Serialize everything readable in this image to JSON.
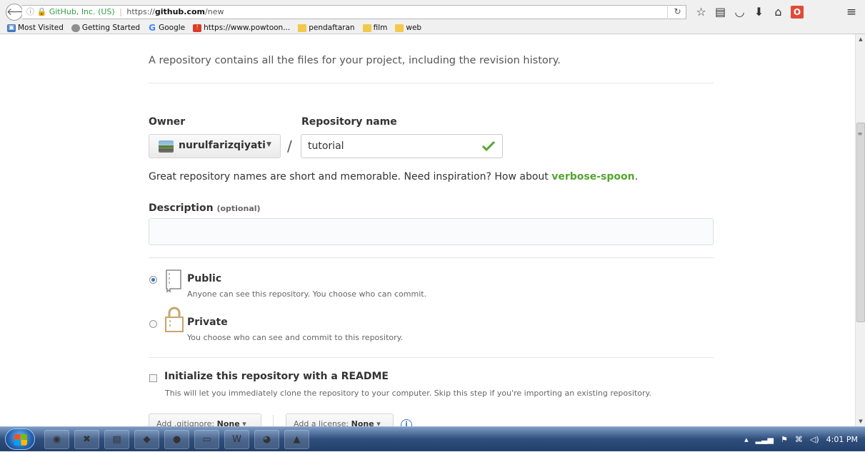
{
  "browser": {
    "url_info": "ⓘ",
    "url_lock": "🔒",
    "url_site": "GitHub, Inc. (US)",
    "url_prefix": "https://",
    "url_domain": "github.com",
    "url_path": "/new",
    "bookmarks": [
      "Most Visited",
      "Getting Started",
      "Google",
      "https://www.powtoon...",
      "pendaftaran",
      "film",
      "web"
    ]
  },
  "form": {
    "intro": "A repository contains all the files for your project, including the revision history.",
    "owner_label": "Owner",
    "repo_label": "Repository name",
    "owner_name": "nurulfarizqiyati",
    "slash": "/",
    "repo_value": "tutorial",
    "hint_text": "Great repository names are short and memorable. Need inspiration? How about ",
    "hint_suggestion": "verbose-spoon",
    "hint_end": ".",
    "desc_label": "Description",
    "desc_optional": "(optional)",
    "desc_value": "",
    "public_title": "Public",
    "public_note": "Anyone can see this repository. You choose who can commit.",
    "private_title": "Private",
    "private_note": "You choose who can see and commit to this repository.",
    "readme_label": "Initialize this repository with a README",
    "readme_note": "This will let you immediately clone the repository to your computer. Skip this step if you're importing an existing repository.",
    "gitignore_prefix": "Add .gitignore:",
    "gitignore_value": "None",
    "license_prefix": "Add a license:",
    "license_value": "None",
    "visibility_selected": "Public"
  },
  "taskbar": {
    "time": "4:01 PM"
  },
  "colors": {
    "accent_green": "#55a532",
    "link_blue": "#4078c0",
    "radio_checked": "#3778b6"
  }
}
